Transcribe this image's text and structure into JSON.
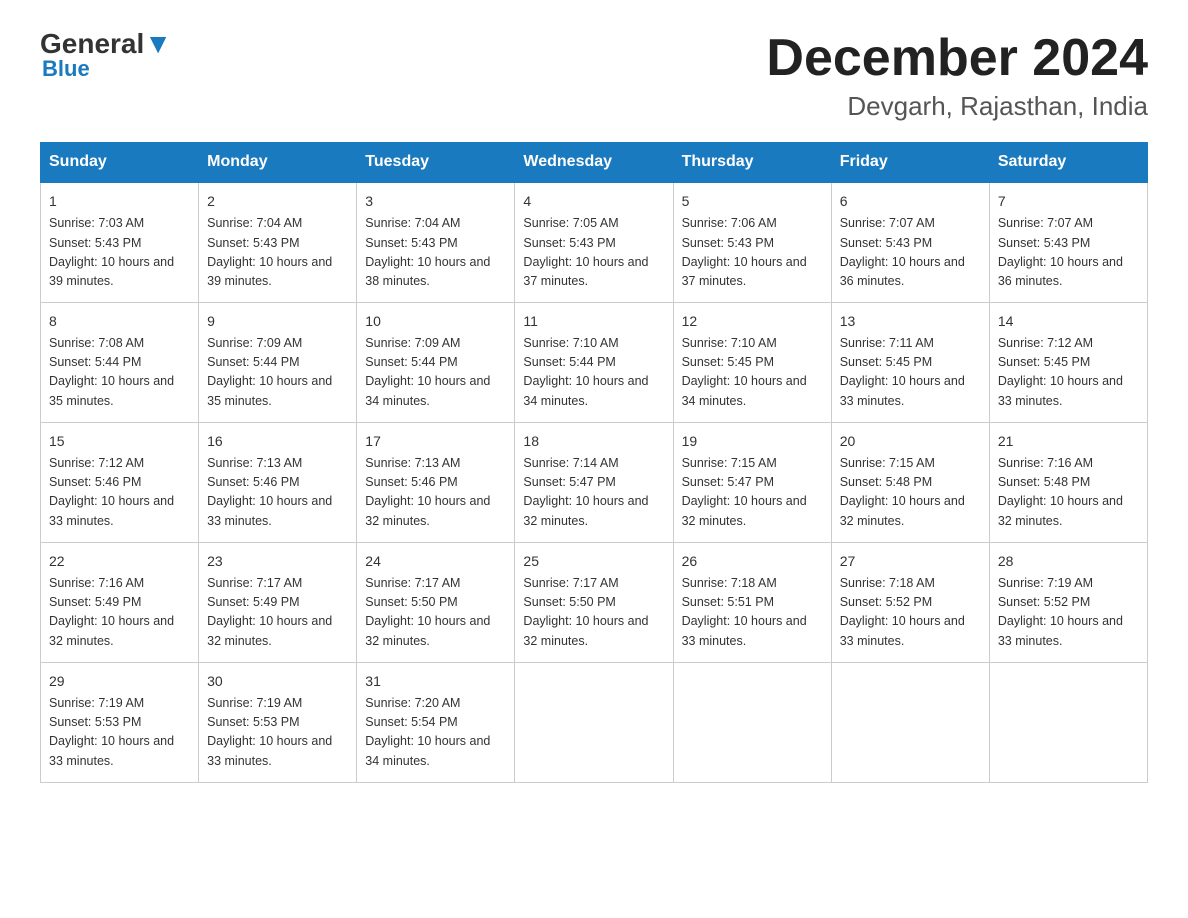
{
  "logo": {
    "general": "General",
    "blue": "Blue"
  },
  "title": "December 2024",
  "subtitle": "Devgarh, Rajasthan, India",
  "days_of_week": [
    "Sunday",
    "Monday",
    "Tuesday",
    "Wednesday",
    "Thursday",
    "Friday",
    "Saturday"
  ],
  "weeks": [
    [
      {
        "num": "1",
        "sunrise": "7:03 AM",
        "sunset": "5:43 PM",
        "daylight": "10 hours and 39 minutes."
      },
      {
        "num": "2",
        "sunrise": "7:04 AM",
        "sunset": "5:43 PM",
        "daylight": "10 hours and 39 minutes."
      },
      {
        "num": "3",
        "sunrise": "7:04 AM",
        "sunset": "5:43 PM",
        "daylight": "10 hours and 38 minutes."
      },
      {
        "num": "4",
        "sunrise": "7:05 AM",
        "sunset": "5:43 PM",
        "daylight": "10 hours and 37 minutes."
      },
      {
        "num": "5",
        "sunrise": "7:06 AM",
        "sunset": "5:43 PM",
        "daylight": "10 hours and 37 minutes."
      },
      {
        "num": "6",
        "sunrise": "7:07 AM",
        "sunset": "5:43 PM",
        "daylight": "10 hours and 36 minutes."
      },
      {
        "num": "7",
        "sunrise": "7:07 AM",
        "sunset": "5:43 PM",
        "daylight": "10 hours and 36 minutes."
      }
    ],
    [
      {
        "num": "8",
        "sunrise": "7:08 AM",
        "sunset": "5:44 PM",
        "daylight": "10 hours and 35 minutes."
      },
      {
        "num": "9",
        "sunrise": "7:09 AM",
        "sunset": "5:44 PM",
        "daylight": "10 hours and 35 minutes."
      },
      {
        "num": "10",
        "sunrise": "7:09 AM",
        "sunset": "5:44 PM",
        "daylight": "10 hours and 34 minutes."
      },
      {
        "num": "11",
        "sunrise": "7:10 AM",
        "sunset": "5:44 PM",
        "daylight": "10 hours and 34 minutes."
      },
      {
        "num": "12",
        "sunrise": "7:10 AM",
        "sunset": "5:45 PM",
        "daylight": "10 hours and 34 minutes."
      },
      {
        "num": "13",
        "sunrise": "7:11 AM",
        "sunset": "5:45 PM",
        "daylight": "10 hours and 33 minutes."
      },
      {
        "num": "14",
        "sunrise": "7:12 AM",
        "sunset": "5:45 PM",
        "daylight": "10 hours and 33 minutes."
      }
    ],
    [
      {
        "num": "15",
        "sunrise": "7:12 AM",
        "sunset": "5:46 PM",
        "daylight": "10 hours and 33 minutes."
      },
      {
        "num": "16",
        "sunrise": "7:13 AM",
        "sunset": "5:46 PM",
        "daylight": "10 hours and 33 minutes."
      },
      {
        "num": "17",
        "sunrise": "7:13 AM",
        "sunset": "5:46 PM",
        "daylight": "10 hours and 32 minutes."
      },
      {
        "num": "18",
        "sunrise": "7:14 AM",
        "sunset": "5:47 PM",
        "daylight": "10 hours and 32 minutes."
      },
      {
        "num": "19",
        "sunrise": "7:15 AM",
        "sunset": "5:47 PM",
        "daylight": "10 hours and 32 minutes."
      },
      {
        "num": "20",
        "sunrise": "7:15 AM",
        "sunset": "5:48 PM",
        "daylight": "10 hours and 32 minutes."
      },
      {
        "num": "21",
        "sunrise": "7:16 AM",
        "sunset": "5:48 PM",
        "daylight": "10 hours and 32 minutes."
      }
    ],
    [
      {
        "num": "22",
        "sunrise": "7:16 AM",
        "sunset": "5:49 PM",
        "daylight": "10 hours and 32 minutes."
      },
      {
        "num": "23",
        "sunrise": "7:17 AM",
        "sunset": "5:49 PM",
        "daylight": "10 hours and 32 minutes."
      },
      {
        "num": "24",
        "sunrise": "7:17 AM",
        "sunset": "5:50 PM",
        "daylight": "10 hours and 32 minutes."
      },
      {
        "num": "25",
        "sunrise": "7:17 AM",
        "sunset": "5:50 PM",
        "daylight": "10 hours and 32 minutes."
      },
      {
        "num": "26",
        "sunrise": "7:18 AM",
        "sunset": "5:51 PM",
        "daylight": "10 hours and 33 minutes."
      },
      {
        "num": "27",
        "sunrise": "7:18 AM",
        "sunset": "5:52 PM",
        "daylight": "10 hours and 33 minutes."
      },
      {
        "num": "28",
        "sunrise": "7:19 AM",
        "sunset": "5:52 PM",
        "daylight": "10 hours and 33 minutes."
      }
    ],
    [
      {
        "num": "29",
        "sunrise": "7:19 AM",
        "sunset": "5:53 PM",
        "daylight": "10 hours and 33 minutes."
      },
      {
        "num": "30",
        "sunrise": "7:19 AM",
        "sunset": "5:53 PM",
        "daylight": "10 hours and 33 minutes."
      },
      {
        "num": "31",
        "sunrise": "7:20 AM",
        "sunset": "5:54 PM",
        "daylight": "10 hours and 34 minutes."
      },
      null,
      null,
      null,
      null
    ]
  ]
}
